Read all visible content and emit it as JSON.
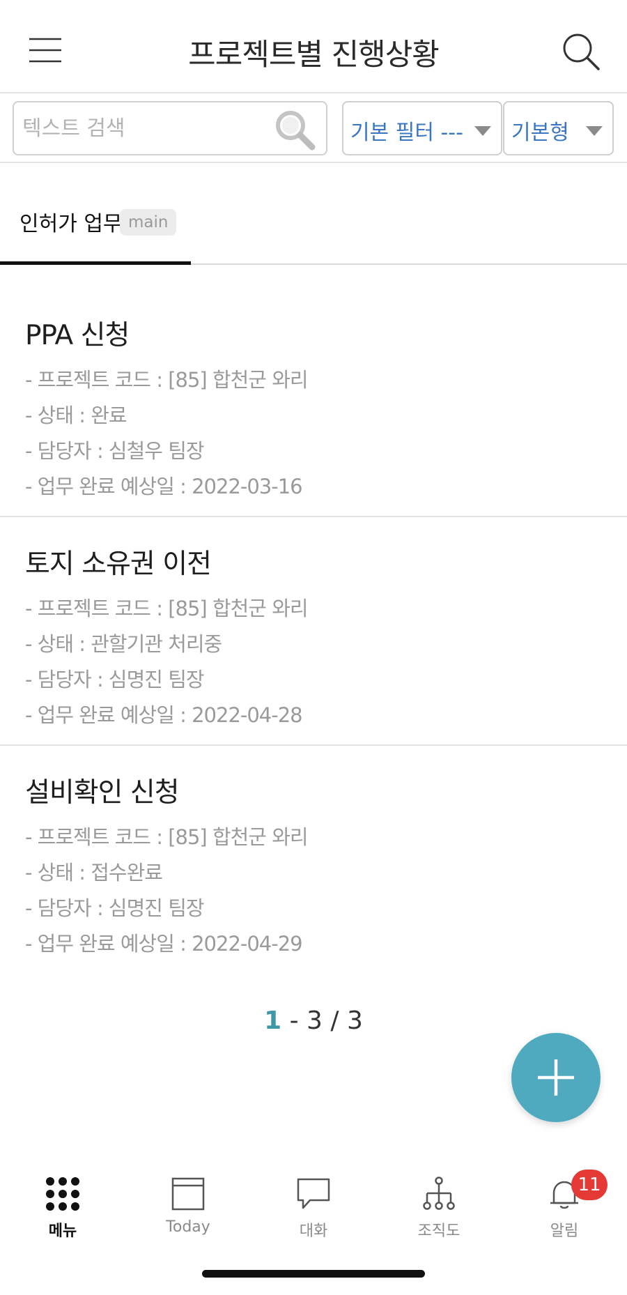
{
  "header": {
    "title": "프로젝트별 진행상황"
  },
  "filter_bar": {
    "search_placeholder": "텍스트 검색",
    "search_value": "",
    "filter_select": "기본 필터 ---",
    "type_select": "기본형"
  },
  "tabs": [
    {
      "label": "인허가 업무",
      "badge": "main",
      "active": true
    }
  ],
  "items": [
    {
      "title": "PPA 신청",
      "project_code": "- 프로젝트 코드 : [85] 합천군 와리",
      "status": "- 상태 : 완료",
      "manager": "- 담당자 : 심철우 팀장",
      "due": "- 업무 완료 예상일 : 2022-03-16"
    },
    {
      "title": "토지 소유권 이전",
      "project_code": "- 프로젝트 코드 : [85] 합천군 와리",
      "status": "- 상태 : 관할기관 처리중",
      "manager": "- 담당자 : 심명진 팀장",
      "due": "- 업무 완료 예상일 : 2022-04-28"
    },
    {
      "title": "설비확인 신청",
      "project_code": "- 프로젝트 코드 : [85] 합천군 와리",
      "status": "- 상태 : 접수완료",
      "manager": "- 담당자 : 심명진 팀장",
      "due": "- 업무 완료 예상일 : 2022-04-29"
    }
  ],
  "pagination": {
    "current": "1",
    "range_rest": " - 3 / 3"
  },
  "bottom_nav": [
    {
      "label": "메뉴",
      "icon": "grid-dots-icon",
      "active": true
    },
    {
      "label": "Today",
      "icon": "calendar-icon",
      "active": false
    },
    {
      "label": "대화",
      "icon": "chat-bubble-icon",
      "active": false
    },
    {
      "label": "조직도",
      "icon": "org-chart-icon",
      "active": false
    },
    {
      "label": "알림",
      "icon": "bell-icon",
      "active": false,
      "badge": "11"
    }
  ],
  "colors": {
    "accent": "#4fa9bf",
    "link_blue": "#3a77c2",
    "badge_red": "#e53935",
    "page_number": "#3f98a8"
  }
}
